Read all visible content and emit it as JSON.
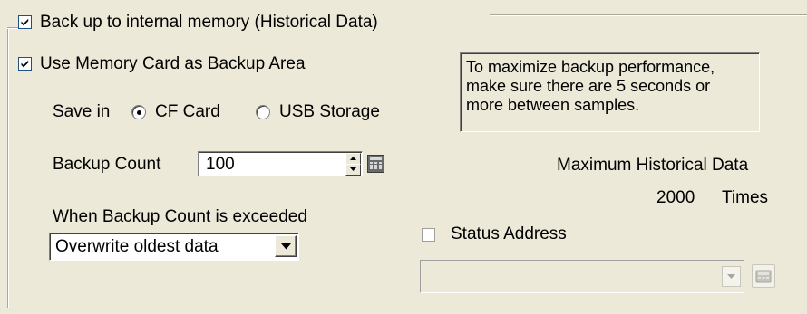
{
  "group": {
    "backup_internal_label": "Back up to internal memory (Historical Data)",
    "backup_internal_checked": true
  },
  "memory_card": {
    "label": "Use Memory Card as Backup Area",
    "checked": true,
    "save_in_label": "Save in",
    "options": [
      {
        "label": "CF Card",
        "selected": true
      },
      {
        "label": "USB Storage",
        "selected": false
      }
    ]
  },
  "info_text": "To maximize backup performance,\nmake sure there are 5 seconds or\nmore between samples.",
  "backup_count": {
    "label": "Backup Count",
    "value": "100"
  },
  "max_hist": {
    "label": "Maximum Historical Data",
    "value": "2000",
    "unit": "Times"
  },
  "exceeded": {
    "label": "When Backup Count is exceeded",
    "selected": "Overwrite oldest data"
  },
  "status_address": {
    "label": "Status Address",
    "checked": false,
    "value": ""
  },
  "colors": {
    "background": "#ECE9D8",
    "checkbox_border": "#1C5180"
  },
  "icons": [
    "check-icon",
    "spin-up-icon",
    "spin-down-icon",
    "keypad-icon",
    "dropdown-arrow-icon"
  ]
}
